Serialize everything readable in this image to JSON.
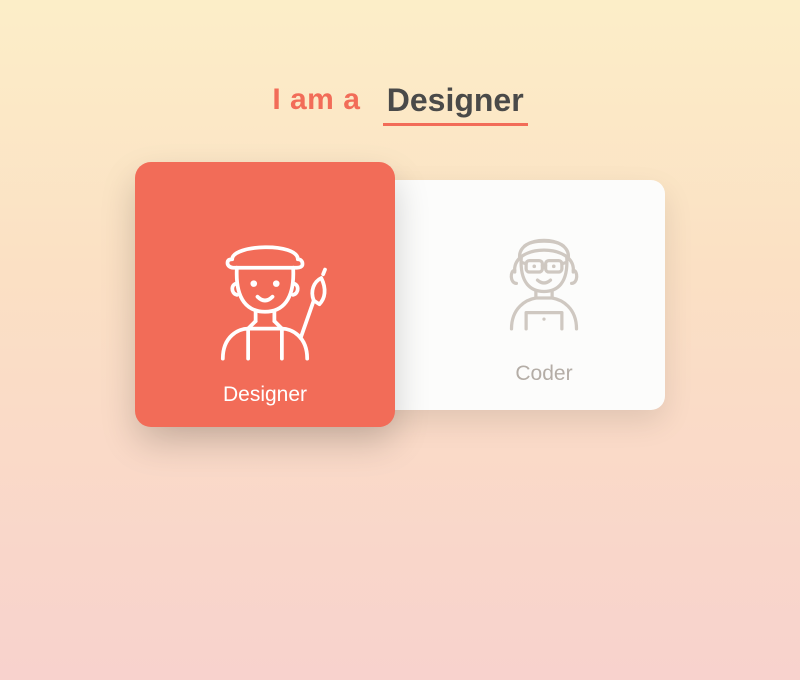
{
  "heading": {
    "prefix": "I am a",
    "selected": "Designer"
  },
  "cards": {
    "designer": {
      "label": "Designer",
      "selected": true,
      "icon": "artist-icon"
    },
    "coder": {
      "label": "Coder",
      "selected": false,
      "icon": "coder-icon"
    }
  },
  "colors": {
    "accent": "#f26c58",
    "heading_text": "#4a4a49",
    "muted": "#b4ada6",
    "card_bg": "#fcfcfb"
  }
}
